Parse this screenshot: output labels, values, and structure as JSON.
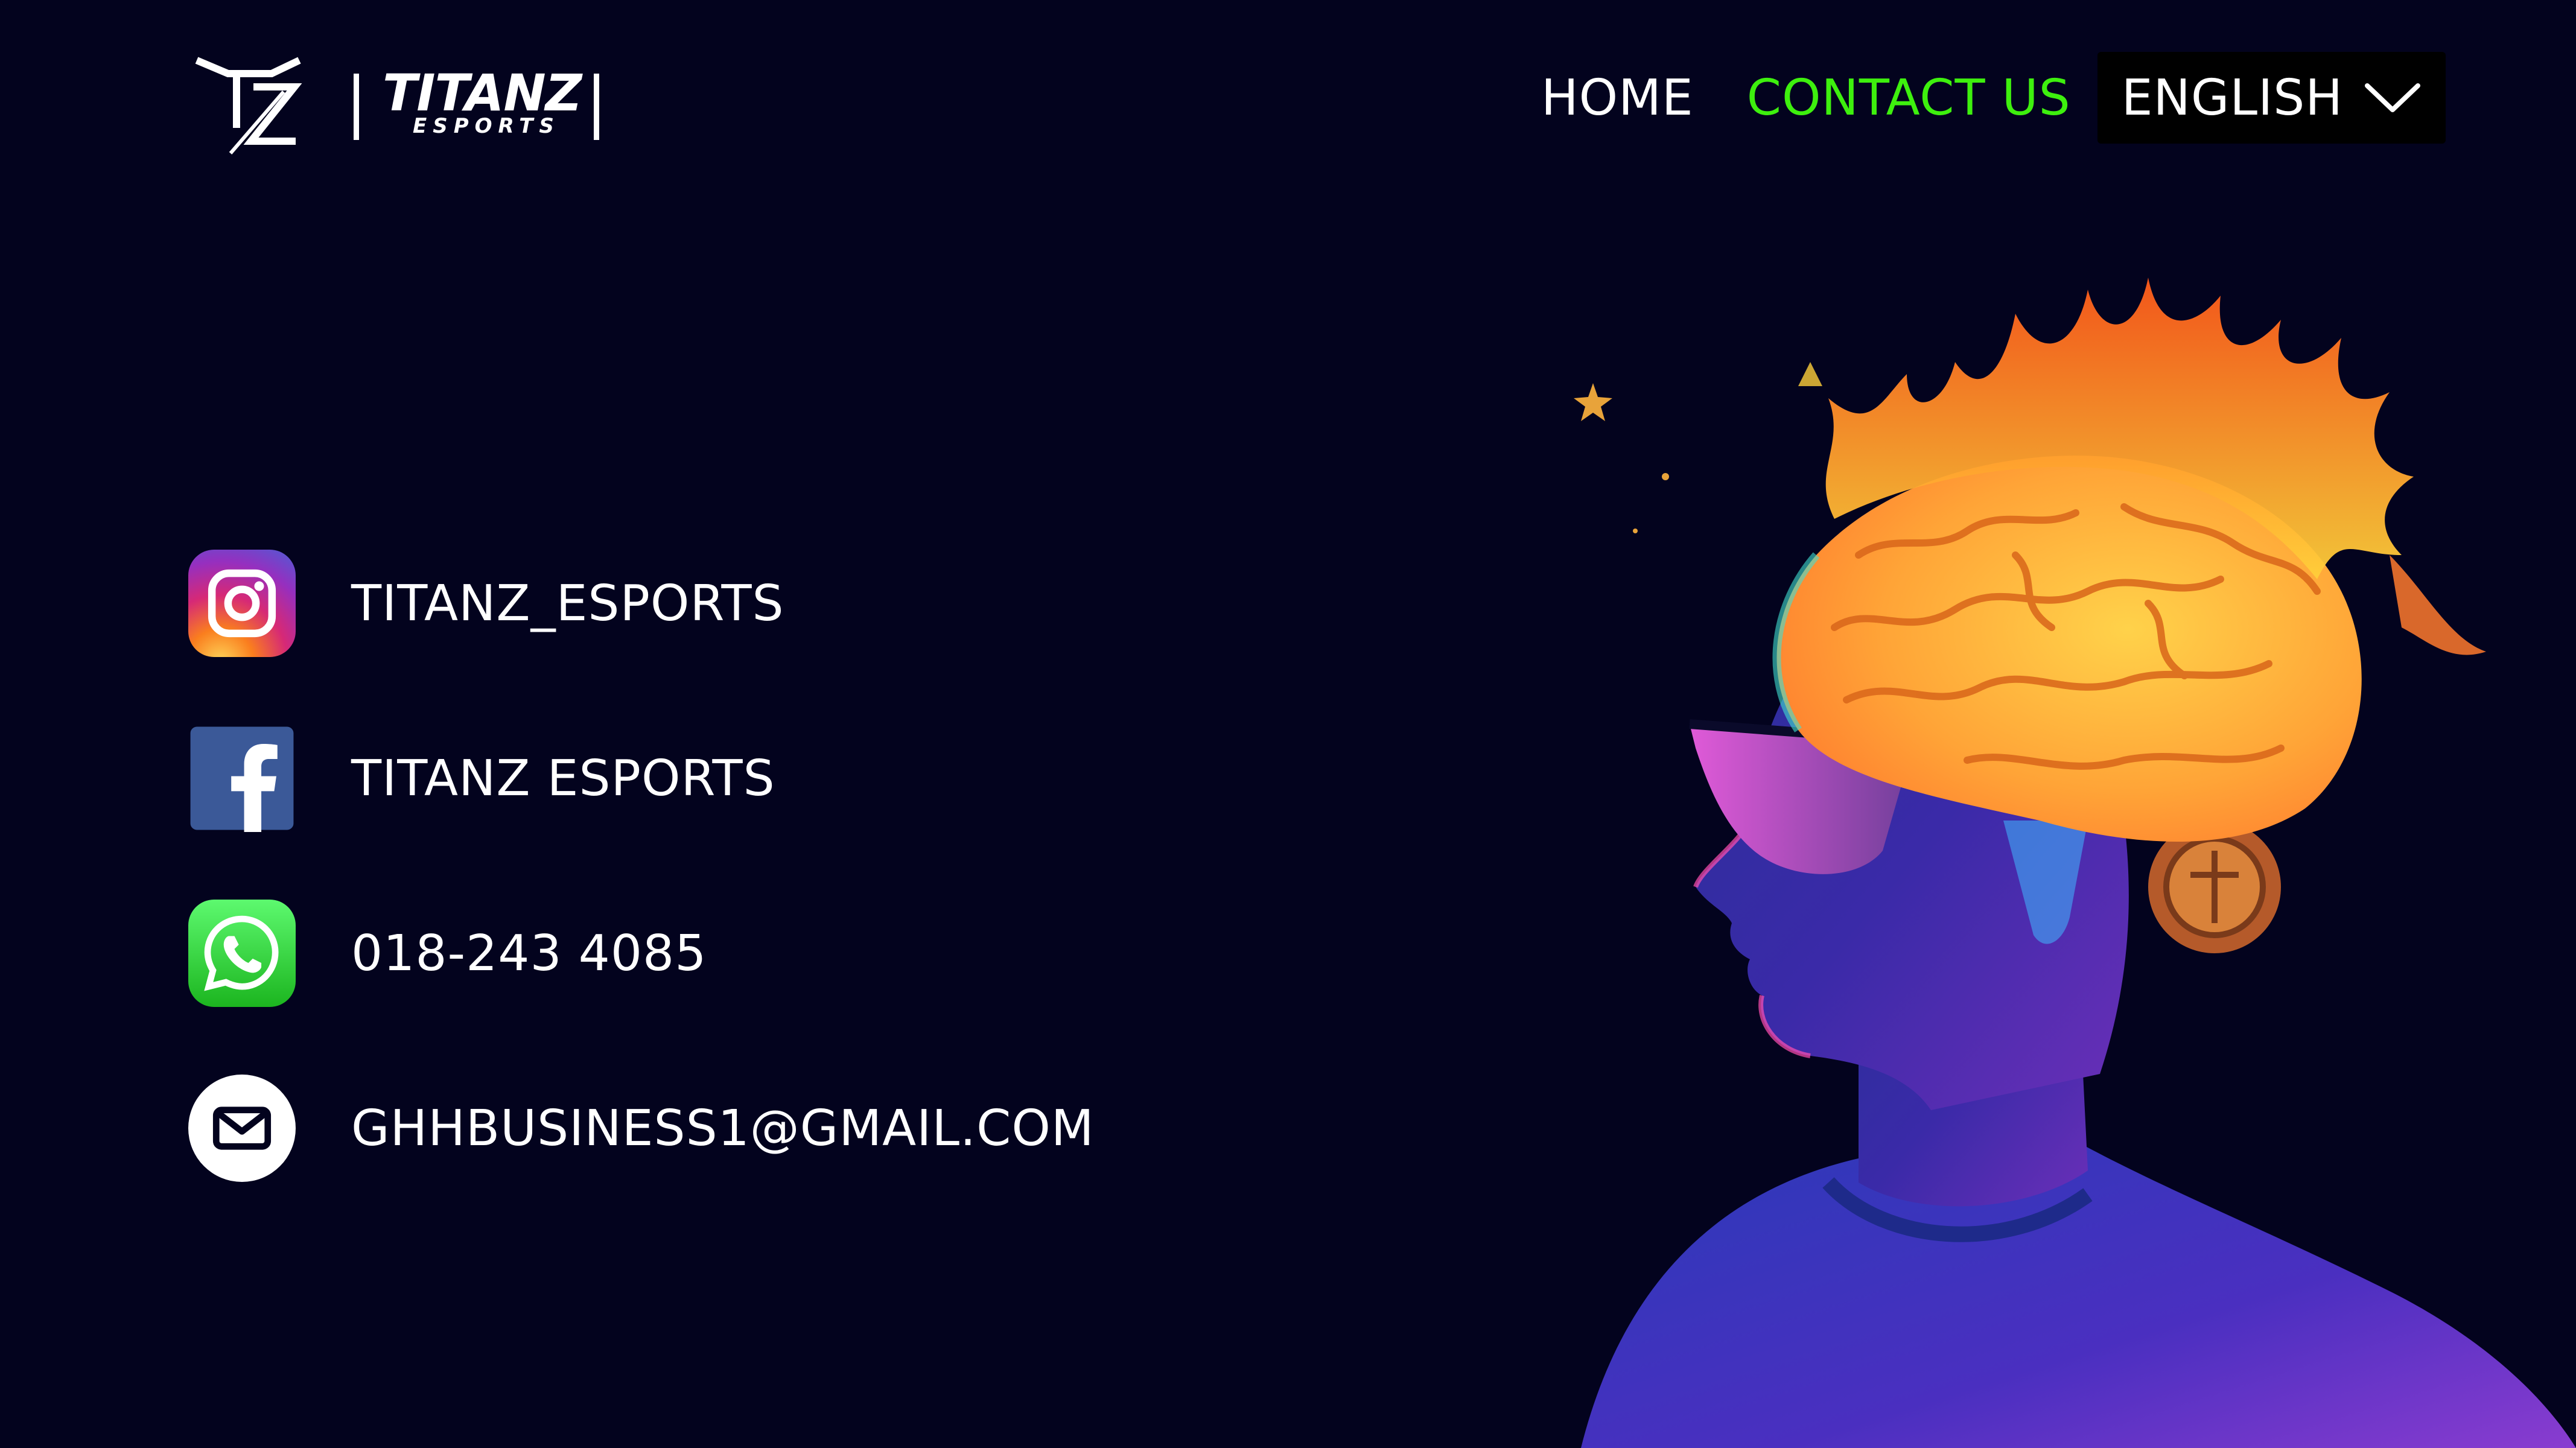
{
  "brand": {
    "name": "TITANZ",
    "subtitle": "ESPORTS",
    "mark": "TZ"
  },
  "nav": {
    "items": [
      {
        "label": "HOME",
        "active": false
      },
      {
        "label": "CONTACT US",
        "active": true
      }
    ],
    "language": {
      "selected": "ENGLISH",
      "icon": "chevron-down-icon"
    }
  },
  "contacts": [
    {
      "icon": "instagram-icon",
      "text": "TITANZ_ESPORTS"
    },
    {
      "icon": "facebook-icon",
      "text": "TITANZ ESPORTS"
    },
    {
      "icon": "whatsapp-icon",
      "text": "018-243 4085"
    },
    {
      "icon": "mail-icon",
      "text": "GHHBUSINESS1@GMAIL.COM"
    }
  ],
  "colors": {
    "background": "#03031e",
    "active_nav": "#3ef00e",
    "text": "#ffffff",
    "language_box": "#000000"
  }
}
